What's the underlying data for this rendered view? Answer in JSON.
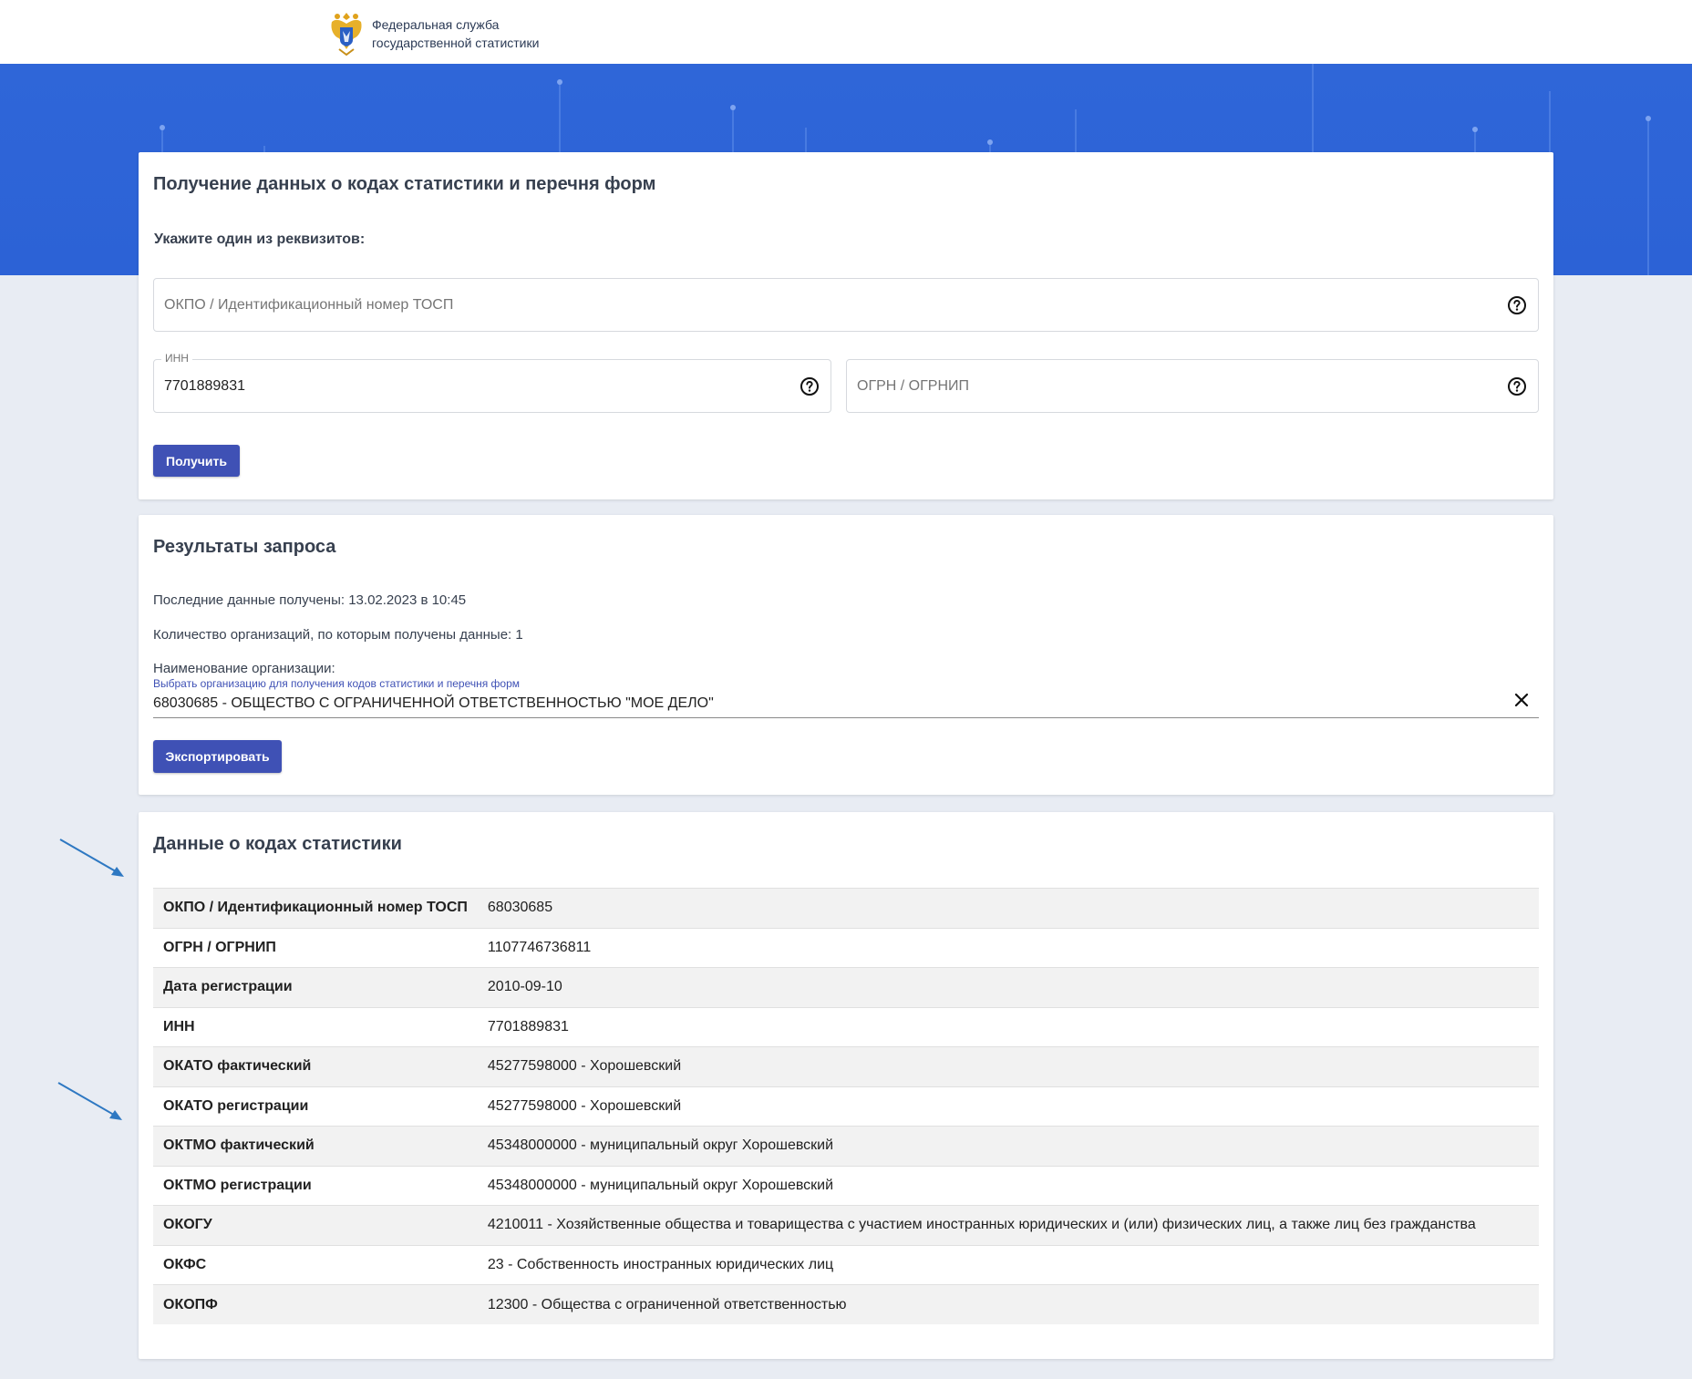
{
  "header": {
    "org_line1": "Федеральная служба",
    "org_line2": "государственной статистики",
    "logo_icon": "emblem-icon"
  },
  "request_form": {
    "title": "Получение данных о кодах статистики и перечня форм",
    "subtitle": "Укажите один из реквизитов:",
    "okpo_placeholder": "ОКПО / Идентификационный номер ТОСП",
    "okpo_value": "",
    "inn_label": "ИНН",
    "inn_value": "7701889831",
    "ogrn_placeholder": "ОГРН / ОГРНИП",
    "ogrn_value": "",
    "submit_label": "Получить"
  },
  "results": {
    "title": "Результаты запроса",
    "last_received": "Последние данные получены: 13.02.2023 в 10:45",
    "org_count": "Количество организаций, по которым получены данные: 1",
    "org_name_label": "Наименование организации:",
    "select_hint": "Выбрать организацию для получения кодов статистики и перечня форм",
    "selected_org": "68030685 - ОБЩЕСТВО С ОГРАНИЧЕННОЙ ОТВЕТСТВЕННОСТЬЮ \"МОЕ ДЕЛО\"",
    "export_label": "Экспортировать"
  },
  "codes": {
    "title": "Данные о кодах статистики",
    "rows": [
      {
        "key": "ОКПО / Идентификационный номер ТОСП",
        "value": "68030685"
      },
      {
        "key": "ОГРН / ОГРНИП",
        "value": "1107746736811"
      },
      {
        "key": "Дата регистрации",
        "value": "2010-09-10"
      },
      {
        "key": "ИНН",
        "value": "7701889831"
      },
      {
        "key": "ОКАТО фактический",
        "value": "45277598000 - Хорошевский"
      },
      {
        "key": "ОКАТО регистрации",
        "value": "45277598000 - Хорошевский"
      },
      {
        "key": "ОКТМО фактический",
        "value": "45348000000 - муниципальный округ Хорошевский"
      },
      {
        "key": "ОКТМО регистрации",
        "value": "45348000000 - муниципальный округ Хорошевский"
      },
      {
        "key": "ОКОГУ",
        "value": "4210011 - Хозяйственные общества и товарищества с участием иностранных юридических и (или) физических лиц, а также лиц без гражданства"
      },
      {
        "key": "ОКФС",
        "value": "23 - Собственность иностранных юридических лиц"
      },
      {
        "key": "ОКОПФ",
        "value": "12300 - Общества с ограниченной ответственностью"
      }
    ]
  },
  "colors": {
    "banner": "#2f66d8",
    "button": "#3f51b5",
    "hint": "#3f51b5",
    "arrow": "#2e78c2"
  }
}
